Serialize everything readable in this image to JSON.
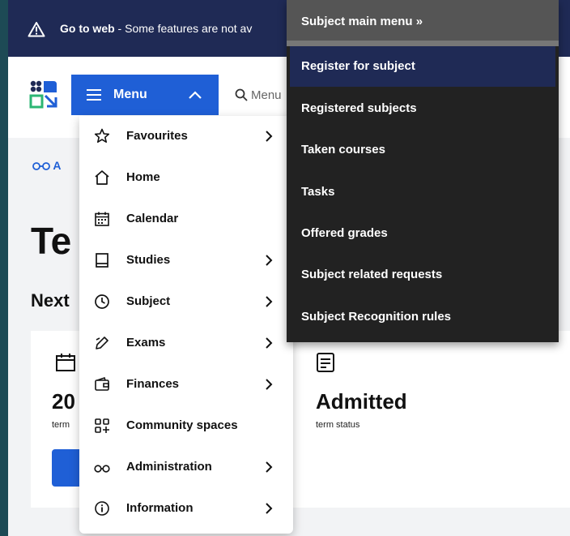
{
  "banner": {
    "bold": "Go to web",
    "rest": " - Some features are not av"
  },
  "header": {
    "menu_label": "Menu",
    "search_placeholder": "Menu"
  },
  "background": {
    "breadcrumb": "A",
    "title": "Te",
    "next_heading": "Next",
    "card": {
      "col1_value": "20",
      "col1_label": "term",
      "col2_value": "Admitted",
      "col2_label": "term status"
    }
  },
  "menu": {
    "items": [
      {
        "label": "Favourites",
        "icon": "star-icon",
        "arrow": true
      },
      {
        "label": "Home",
        "icon": "home-icon",
        "arrow": false
      },
      {
        "label": "Calendar",
        "icon": "calendar-icon",
        "arrow": false
      },
      {
        "label": "Studies",
        "icon": "book-icon",
        "arrow": true
      },
      {
        "label": "Subject",
        "icon": "clock-icon",
        "arrow": true
      },
      {
        "label": "Exams",
        "icon": "pencil-icon",
        "arrow": true
      },
      {
        "label": "Finances",
        "icon": "wallet-icon",
        "arrow": true
      },
      {
        "label": "Community spaces",
        "icon": "grid-plus-icon",
        "arrow": false
      },
      {
        "label": "Administration",
        "icon": "glasses-icon",
        "arrow": true
      },
      {
        "label": "Information",
        "icon": "info-icon",
        "arrow": true
      }
    ]
  },
  "submenu": {
    "header": "Subject main menu »",
    "items": [
      {
        "label": "Register for subject",
        "active": true
      },
      {
        "label": "Registered subjects",
        "active": false
      },
      {
        "label": "Taken courses",
        "active": false
      },
      {
        "label": "Tasks",
        "active": false
      },
      {
        "label": "Offered grades",
        "active": false
      },
      {
        "label": "Subject related requests",
        "active": false
      },
      {
        "label": "Subject Recognition rules",
        "active": false
      }
    ]
  },
  "colors": {
    "banner_bg": "#1f2a55",
    "accent": "#1f5fd6",
    "submenu_bg": "#222222",
    "submenu_active": "#1f2a55"
  }
}
